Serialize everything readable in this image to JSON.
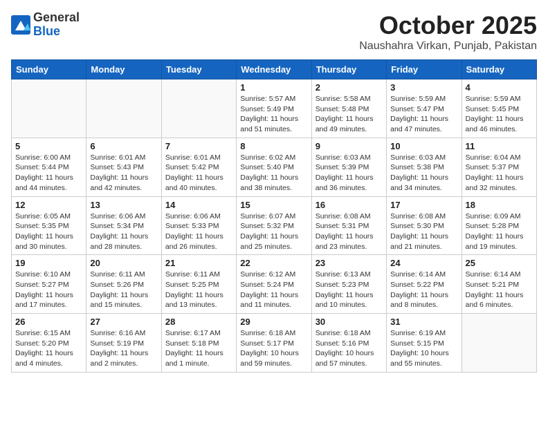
{
  "logo": {
    "general": "General",
    "blue": "Blue"
  },
  "header": {
    "month": "October 2025",
    "location": "Naushahra Virkan, Punjab, Pakistan"
  },
  "days_of_week": [
    "Sunday",
    "Monday",
    "Tuesday",
    "Wednesday",
    "Thursday",
    "Friday",
    "Saturday"
  ],
  "weeks": [
    [
      {
        "day": "",
        "info": ""
      },
      {
        "day": "",
        "info": ""
      },
      {
        "day": "",
        "info": ""
      },
      {
        "day": "1",
        "info": "Sunrise: 5:57 AM\nSunset: 5:49 PM\nDaylight: 11 hours\nand 51 minutes."
      },
      {
        "day": "2",
        "info": "Sunrise: 5:58 AM\nSunset: 5:48 PM\nDaylight: 11 hours\nand 49 minutes."
      },
      {
        "day": "3",
        "info": "Sunrise: 5:59 AM\nSunset: 5:47 PM\nDaylight: 11 hours\nand 47 minutes."
      },
      {
        "day": "4",
        "info": "Sunrise: 5:59 AM\nSunset: 5:45 PM\nDaylight: 11 hours\nand 46 minutes."
      }
    ],
    [
      {
        "day": "5",
        "info": "Sunrise: 6:00 AM\nSunset: 5:44 PM\nDaylight: 11 hours\nand 44 minutes."
      },
      {
        "day": "6",
        "info": "Sunrise: 6:01 AM\nSunset: 5:43 PM\nDaylight: 11 hours\nand 42 minutes."
      },
      {
        "day": "7",
        "info": "Sunrise: 6:01 AM\nSunset: 5:42 PM\nDaylight: 11 hours\nand 40 minutes."
      },
      {
        "day": "8",
        "info": "Sunrise: 6:02 AM\nSunset: 5:40 PM\nDaylight: 11 hours\nand 38 minutes."
      },
      {
        "day": "9",
        "info": "Sunrise: 6:03 AM\nSunset: 5:39 PM\nDaylight: 11 hours\nand 36 minutes."
      },
      {
        "day": "10",
        "info": "Sunrise: 6:03 AM\nSunset: 5:38 PM\nDaylight: 11 hours\nand 34 minutes."
      },
      {
        "day": "11",
        "info": "Sunrise: 6:04 AM\nSunset: 5:37 PM\nDaylight: 11 hours\nand 32 minutes."
      }
    ],
    [
      {
        "day": "12",
        "info": "Sunrise: 6:05 AM\nSunset: 5:35 PM\nDaylight: 11 hours\nand 30 minutes."
      },
      {
        "day": "13",
        "info": "Sunrise: 6:06 AM\nSunset: 5:34 PM\nDaylight: 11 hours\nand 28 minutes."
      },
      {
        "day": "14",
        "info": "Sunrise: 6:06 AM\nSunset: 5:33 PM\nDaylight: 11 hours\nand 26 minutes."
      },
      {
        "day": "15",
        "info": "Sunrise: 6:07 AM\nSunset: 5:32 PM\nDaylight: 11 hours\nand 25 minutes."
      },
      {
        "day": "16",
        "info": "Sunrise: 6:08 AM\nSunset: 5:31 PM\nDaylight: 11 hours\nand 23 minutes."
      },
      {
        "day": "17",
        "info": "Sunrise: 6:08 AM\nSunset: 5:30 PM\nDaylight: 11 hours\nand 21 minutes."
      },
      {
        "day": "18",
        "info": "Sunrise: 6:09 AM\nSunset: 5:28 PM\nDaylight: 11 hours\nand 19 minutes."
      }
    ],
    [
      {
        "day": "19",
        "info": "Sunrise: 6:10 AM\nSunset: 5:27 PM\nDaylight: 11 hours\nand 17 minutes."
      },
      {
        "day": "20",
        "info": "Sunrise: 6:11 AM\nSunset: 5:26 PM\nDaylight: 11 hours\nand 15 minutes."
      },
      {
        "day": "21",
        "info": "Sunrise: 6:11 AM\nSunset: 5:25 PM\nDaylight: 11 hours\nand 13 minutes."
      },
      {
        "day": "22",
        "info": "Sunrise: 6:12 AM\nSunset: 5:24 PM\nDaylight: 11 hours\nand 11 minutes."
      },
      {
        "day": "23",
        "info": "Sunrise: 6:13 AM\nSunset: 5:23 PM\nDaylight: 11 hours\nand 10 minutes."
      },
      {
        "day": "24",
        "info": "Sunrise: 6:14 AM\nSunset: 5:22 PM\nDaylight: 11 hours\nand 8 minutes."
      },
      {
        "day": "25",
        "info": "Sunrise: 6:14 AM\nSunset: 5:21 PM\nDaylight: 11 hours\nand 6 minutes."
      }
    ],
    [
      {
        "day": "26",
        "info": "Sunrise: 6:15 AM\nSunset: 5:20 PM\nDaylight: 11 hours\nand 4 minutes."
      },
      {
        "day": "27",
        "info": "Sunrise: 6:16 AM\nSunset: 5:19 PM\nDaylight: 11 hours\nand 2 minutes."
      },
      {
        "day": "28",
        "info": "Sunrise: 6:17 AM\nSunset: 5:18 PM\nDaylight: 11 hours\nand 1 minute."
      },
      {
        "day": "29",
        "info": "Sunrise: 6:18 AM\nSunset: 5:17 PM\nDaylight: 10 hours\nand 59 minutes."
      },
      {
        "day": "30",
        "info": "Sunrise: 6:18 AM\nSunset: 5:16 PM\nDaylight: 10 hours\nand 57 minutes."
      },
      {
        "day": "31",
        "info": "Sunrise: 6:19 AM\nSunset: 5:15 PM\nDaylight: 10 hours\nand 55 minutes."
      },
      {
        "day": "",
        "info": ""
      }
    ]
  ]
}
